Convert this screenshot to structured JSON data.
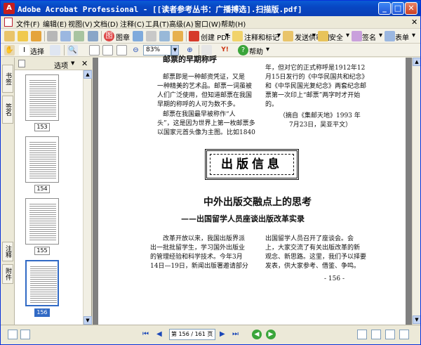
{
  "window": {
    "title": "Adobe Acrobat Professional - [[读者参考丛书：广播搏选].扫描版.pdf]",
    "app_icon": "acrobat-icon",
    "buttons": {
      "minimize": "_",
      "maximize": "□",
      "close": "✕"
    }
  },
  "menu": {
    "items": [
      "文件(F)",
      "编辑(E)",
      "视图(V)",
      "文档(D)",
      "注释(C)",
      "工具(T)",
      "高级(A)",
      "窗口(W)",
      "帮助(H)"
    ],
    "close_glyph": "✕"
  },
  "toolbar1": {
    "create_pdf": "创建 PDF",
    "comment_markup": "注释和标记",
    "send_review": "发送供审阅",
    "secure": "安全",
    "sign": "签名",
    "forms": "表单",
    "organize": "图章",
    "dropdown_glyph": "▾"
  },
  "toolbar2": {
    "hand": "手形",
    "select": "选择",
    "zoom_value": "83%",
    "help": "帮助",
    "zoom_arrow": "▼",
    "yahoo": "Y!"
  },
  "nav_panel": {
    "options_label": "选项",
    "options_arrow": "▼",
    "close_glyph": "✕",
    "tabs": [
      "书签",
      "签名",
      "注释",
      "附件"
    ],
    "thumbnails": [
      {
        "page": "153",
        "selected": false
      },
      {
        "page": "154",
        "selected": false
      },
      {
        "page": "155",
        "selected": false
      },
      {
        "page": "156",
        "selected": true
      }
    ]
  },
  "document": {
    "left_col_top": [
      "邮票的早期称呼",
      "邮票即是一种邮资凭证，又是",
      "一种精美的艺术品。邮票一词虽被",
      "人们广泛使用，但知道邮票在我国",
      "早期的称呼的人可为数不多。",
      "邮票在我国最早被称作“人",
      "头”，这是因为世界上第一枚邮票多",
      "以国家元首头像为主图。比如1840"
    ],
    "right_col_top": [
      "年，但对它的正式称呼是1912年12",
      "月15日发行的《中华民国共和纪念》",
      "和《中华民国光复纪念》两套纪念邮",
      "票第一次印上“邮票”两字时才开始",
      "的。",
      "（摘自《集邮天地》1993 年",
      "7月23日，吴亚平文）"
    ],
    "banner": "出版信息",
    "headline": "中外出版交融点上的思考",
    "subhead": "——出国留学人员座谈出版改革实录",
    "left_col_bottom": [
      "改革开放以来，我国出版界派",
      "出一批批留学生，学习国外出版业",
      "的管理经验和科学技术。今年3月",
      "14日—19日，新闻出版署邀请部分"
    ],
    "right_col_bottom": [
      "出国留学人员召开了座谈会。会",
      "上，大家交流了有关出版改革的新",
      "观念、新思路。这里，我们予以择要",
      "发表，供大家参考、借鉴、争鸣。"
    ],
    "page_number": "- 156 -"
  },
  "statusbar": {
    "page_field": "第 156 / 161 页",
    "first": "⏮",
    "prev": "◀",
    "next": "▶",
    "last": "⏭",
    "back": "◀",
    "forward": "▶"
  }
}
